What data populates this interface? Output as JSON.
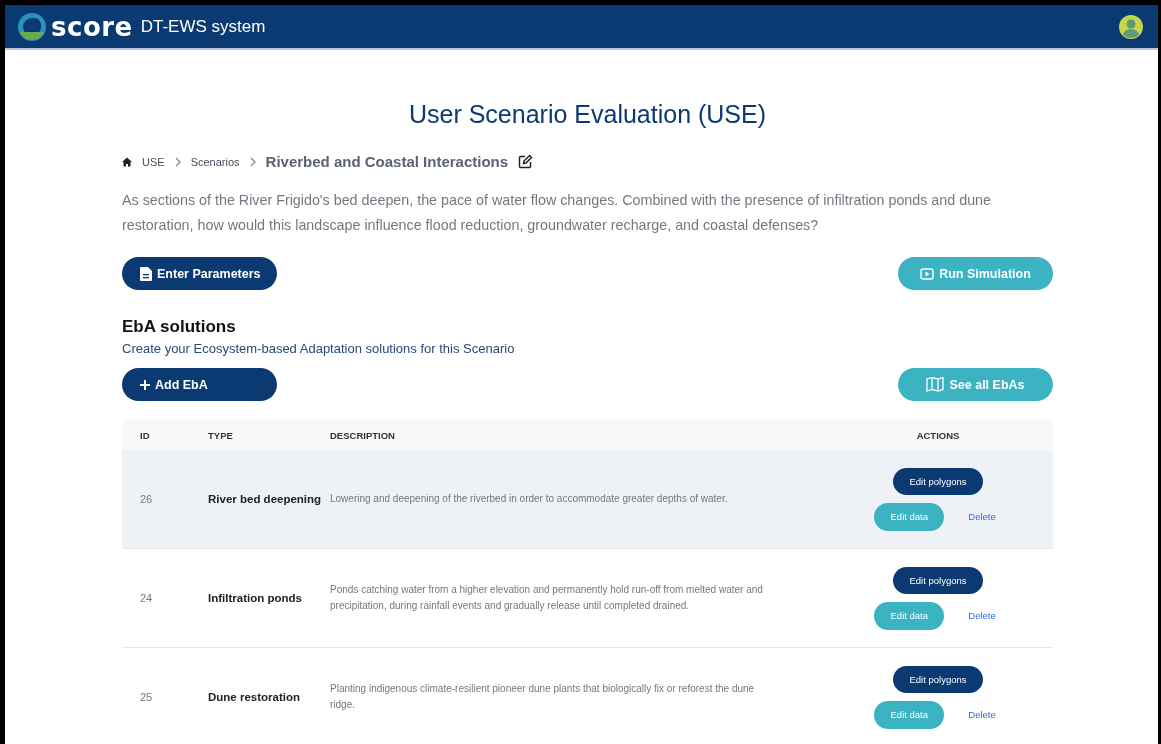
{
  "header": {
    "brand": "score",
    "app_name": "DT-EWS system"
  },
  "page_title": "User Scenario Evaluation (USE)",
  "breadcrumb": [
    {
      "label": "USE",
      "kind": "home"
    },
    {
      "label": "Scenarios",
      "kind": "link"
    },
    {
      "label": "Riverbed and Coastal Interactions",
      "kind": "current"
    }
  ],
  "description": "As sections of the River Frigido's bed deepen, the pace of water flow changes. Combined with the presence of infiltration ponds and dune restoration, how would this landscape influence flood reduction, groundwater recharge, and coastal defenses?",
  "top_buttons": [
    {
      "label": "Enter Parameters",
      "kind": "primary"
    },
    {
      "label": "Run Simulation",
      "kind": "secondary"
    }
  ],
  "eba_section": {
    "title": "EbA solutions",
    "subtitle": "Create your Ecosystem-based Adaptation solutions for this Scenario"
  },
  "eba_buttons": [
    {
      "label": "Add EbA",
      "kind": "primary"
    },
    {
      "label": "See all EbAs",
      "kind": "secondary"
    }
  ],
  "table": {
    "columns": [
      "ID",
      "TYPE",
      "DESCRIPTION",
      "ACTIONS"
    ],
    "rows": [
      {
        "id": "26",
        "type": "River bed deepening",
        "description": "Lowering and deepening of the riverbed in order to accommodate greater depths of water.",
        "highlighted": true,
        "actions": [
          "Edit polygons",
          "Edit data",
          "Delete"
        ]
      },
      {
        "id": "24",
        "type": "Infiltration ponds",
        "description": "Ponds catching water from a higher elevation and permanently hold run-off from melted water and precipitation, during rainfall events and gradually release until completed drained.",
        "highlighted": false,
        "actions": [
          "Edit polygons",
          "Edit data",
          "Delete"
        ]
      },
      {
        "id": "25",
        "type": "Dune restoration",
        "description": "Planting indigenous climate-resilient pioneer dune plants that biologically fix or reforest the dune ridge.",
        "highlighted": false,
        "actions": [
          "Edit polygons",
          "Edit data",
          "Delete"
        ]
      }
    ]
  }
}
